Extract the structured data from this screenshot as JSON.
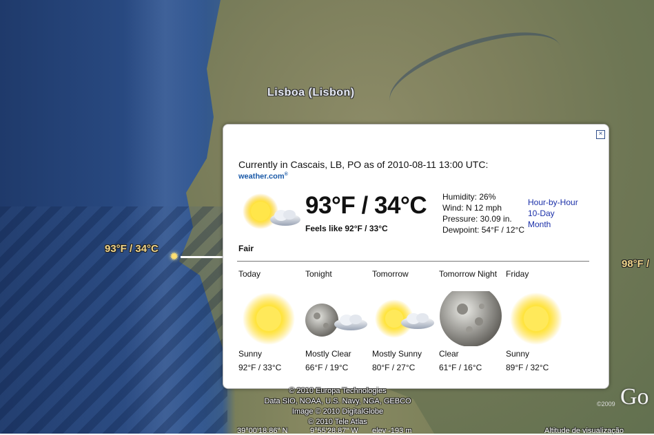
{
  "map": {
    "city_label": "Lisboa (Lisbon)",
    "placemark_temp": "93°F / 34°C",
    "right_edge_temp": "98°F /",
    "credits": [
      "© 2010 Europa Technologies",
      "Data SIO, NOAA, U.S. Navy, NGA, GEBCO",
      "Image © 2010 DigitalGlobe",
      "© 2010 Tele Atlas"
    ],
    "status": {
      "lat": "39°00'18.86\" N",
      "lon": "9°55'28.87\" W",
      "elev": "elev -193 m",
      "altitude": "Altitude de visualização"
    },
    "google_copyright": "©2009",
    "google_logo": "Go"
  },
  "balloon": {
    "close_symbol": "×",
    "current_line": "Currently in Cascais, LB, PO as of 2010-08-11 13:00 UTC:",
    "provider": "weather.com",
    "provider_mark": "®",
    "current_icon": "sun-with-cloud-icon",
    "big_temp": "93°F / 34°C",
    "feels_like": "Feels like 92°F / 33°C",
    "condition": "Fair",
    "details": [
      "Humidity: 26%",
      "Wind: N 12 mph",
      "Pressure: 30.09 in.",
      "Dewpoint: 54°F / 12°C"
    ],
    "links": [
      "Hour-by-Hour",
      "10-Day",
      "Month"
    ],
    "forecast": [
      {
        "period": "Today",
        "icon": "sun-icon",
        "condition": "Sunny",
        "temp": "92°F / 33°C"
      },
      {
        "period": "Tonight",
        "icon": "moon-with-cloud-icon",
        "condition": "Mostly Clear",
        "temp": "66°F / 19°C"
      },
      {
        "period": "Tomorrow",
        "icon": "sun-with-cloud-icon",
        "condition": "Mostly Sunny",
        "temp": "80°F / 27°C"
      },
      {
        "period": "Tomorrow Night",
        "icon": "moon-icon",
        "condition": "Clear",
        "temp": "61°F / 16°C"
      },
      {
        "period": "Friday",
        "icon": "sun-icon",
        "condition": "Sunny",
        "temp": "89°F / 32°C"
      }
    ]
  },
  "colors": {
    "link": "#1a2fa8",
    "provider": "#1b5aa8",
    "map_label": "#f0d58a",
    "ocean": "#294a82"
  }
}
